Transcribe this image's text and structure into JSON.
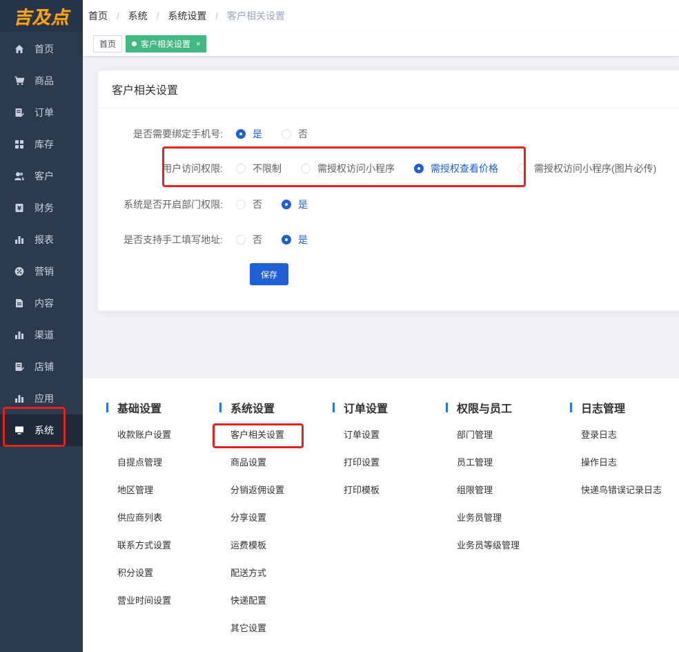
{
  "app": {
    "logo_text": "吉及点",
    "colors": {
      "sidebar": "#2b3a4d",
      "primary": "#1f5fd8",
      "tag_active": "#42b983",
      "highlight": "#e8211c"
    }
  },
  "sidebar": {
    "items": [
      {
        "label": "首页",
        "icon": "home-icon"
      },
      {
        "label": "商品",
        "icon": "cart-icon"
      },
      {
        "label": "订单",
        "icon": "order-icon"
      },
      {
        "label": "库存",
        "icon": "grid-icon"
      },
      {
        "label": "客户",
        "icon": "users-icon"
      },
      {
        "label": "财务",
        "icon": "finance-icon"
      },
      {
        "label": "报表",
        "icon": "bar-chart-icon"
      },
      {
        "label": "营销",
        "icon": "percent-icon"
      },
      {
        "label": "内容",
        "icon": "document-icon"
      },
      {
        "label": "渠道",
        "icon": "bar-chart-icon"
      },
      {
        "label": "店铺",
        "icon": "store-icon"
      },
      {
        "label": "应用",
        "icon": "bar-chart-icon"
      },
      {
        "label": "系统",
        "icon": "monitor-icon",
        "active": true
      }
    ]
  },
  "breadcrumb": {
    "items": [
      "首页",
      "系统",
      "系统设置",
      "客户相关设置"
    ]
  },
  "tabs": {
    "home": "首页",
    "active": "客户相关设置",
    "close": "×"
  },
  "card": {
    "title": "客户相关设置",
    "rows": [
      {
        "label": "是否需要绑定手机号:",
        "options": [
          {
            "label": "是",
            "checked": true
          },
          {
            "label": "否",
            "checked": false
          }
        ]
      },
      {
        "label": "用户访问权限:",
        "options": [
          {
            "label": "不限制",
            "checked": false
          },
          {
            "label": "需授权访问小程序",
            "checked": false
          },
          {
            "label": "需授权查看价格",
            "checked": true
          },
          {
            "label": "需授权访问小程序(图片必传)",
            "checked": false
          }
        ]
      },
      {
        "label": "系统是否开启部门权限:",
        "options": [
          {
            "label": "否",
            "checked": false
          },
          {
            "label": "是",
            "checked": true
          }
        ]
      },
      {
        "label": "是否支持手工填写地址:",
        "options": [
          {
            "label": "否",
            "checked": false
          },
          {
            "label": "是",
            "checked": true
          }
        ]
      }
    ],
    "save_label": "保存"
  },
  "settings_menu": {
    "columns": [
      {
        "title": "基础设置",
        "links": [
          "收款账户设置",
          "自提点管理",
          "地区管理",
          "供应商列表",
          "联系方式设置",
          "积分设置",
          "营业时间设置"
        ]
      },
      {
        "title": "系统设置",
        "links": [
          "客户相关设置",
          "商品设置",
          "分销返佣设置",
          "分享设置",
          "运费模板",
          "配送方式",
          "快递配置",
          "其它设置"
        ]
      },
      {
        "title": "订单设置",
        "links": [
          "订单设置",
          "打印设置",
          "打印模板"
        ]
      },
      {
        "title": "权限与员工",
        "links": [
          "部门管理",
          "员工管理",
          "组限管理",
          "业务员管理",
          "业务员等级管理"
        ]
      },
      {
        "title": "日志管理",
        "links": [
          "登录日志",
          "操作日志",
          "快递鸟错误记录日志"
        ]
      }
    ]
  }
}
